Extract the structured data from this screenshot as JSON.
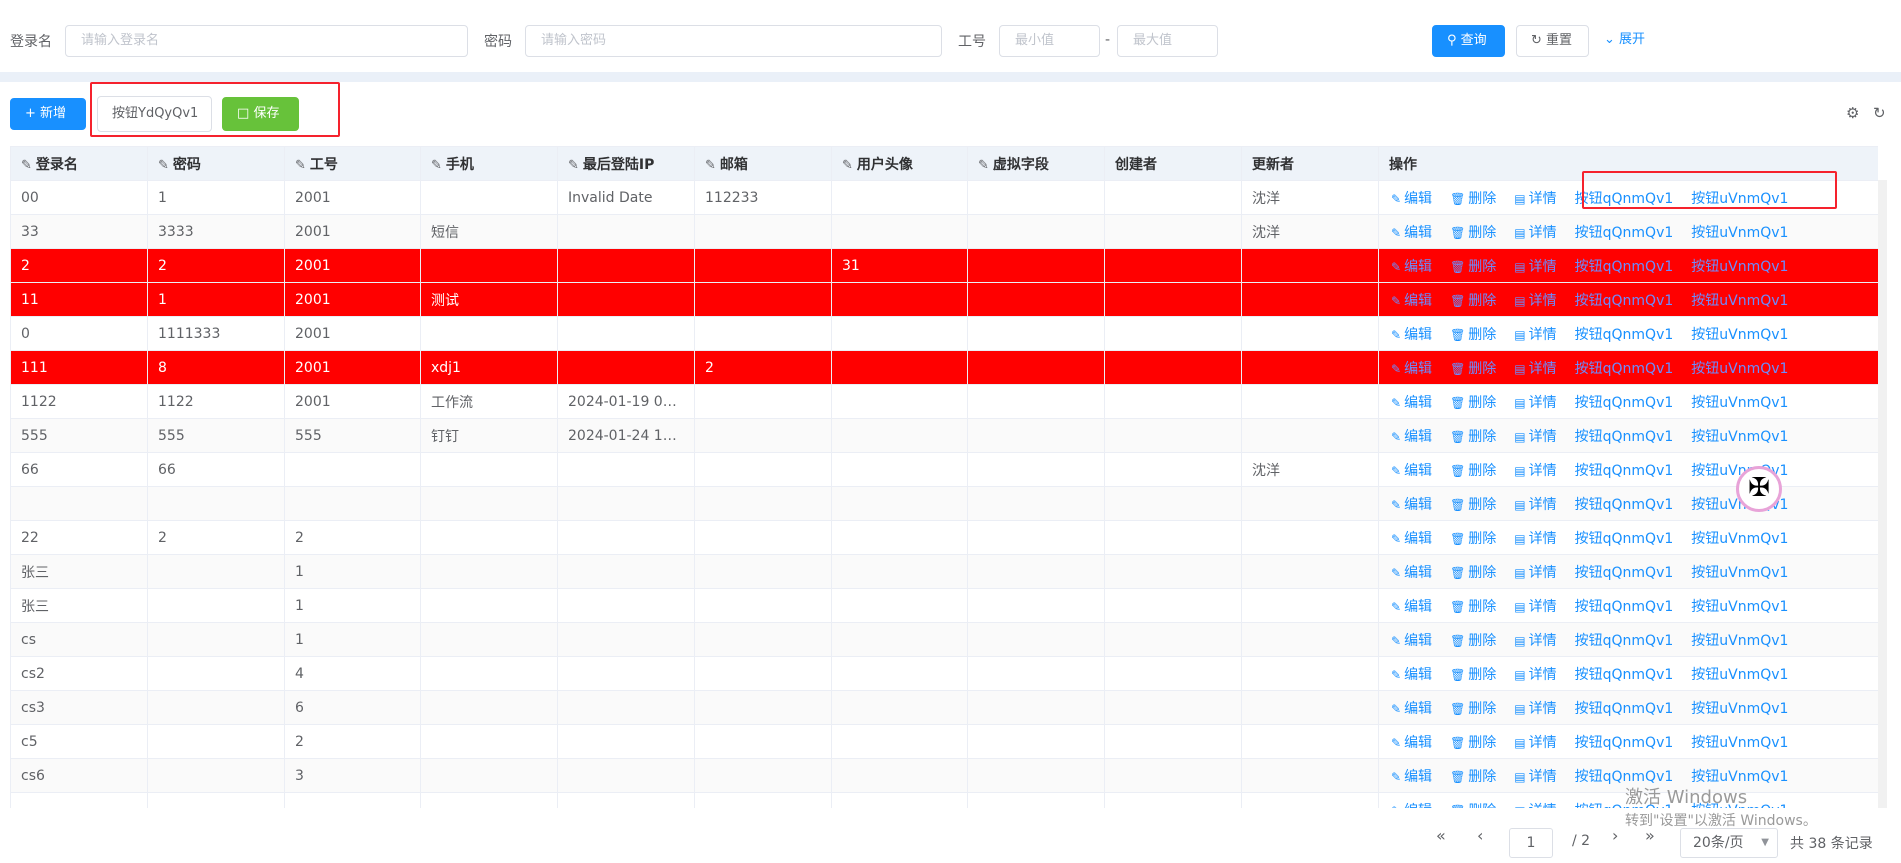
{
  "search": {
    "login_label": "登录名",
    "login_placeholder": "请输入登录名",
    "password_label": "密码",
    "password_placeholder": "请输入密码",
    "jobno_label": "工号",
    "jobno_min_placeholder": "最小值",
    "jobno_max_placeholder": "最大值",
    "range_sep": "-",
    "query_label": "查询",
    "reset_label": "重置",
    "expand_label": "展开"
  },
  "toolbar": {
    "add_label": "新增",
    "custom_button_label": "按钮YdQyQv1",
    "save_label": "保存"
  },
  "table": {
    "columns": [
      "登录名",
      "密码",
      "工号",
      "手机",
      "最后登陆IP",
      "邮箱",
      "用户头像",
      "虚拟字段",
      "创建者",
      "更新者",
      "操作"
    ],
    "actions": [
      "编辑",
      "删除",
      "详情",
      "按钮qQnmQv1",
      "按钮uVnmQv1"
    ],
    "rows": [
      {
        "c": [
          "00",
          "1",
          "2001",
          "",
          "Invalid Date",
          "112233",
          "",
          "",
          "",
          "沈洋"
        ],
        "hl": false
      },
      {
        "c": [
          "33",
          "3333",
          "2001",
          "短信",
          "",
          "",
          "",
          "",
          "",
          "沈洋"
        ],
        "hl": false
      },
      {
        "c": [
          "2",
          "2",
          "2001",
          "",
          "",
          "",
          "31",
          "",
          "",
          ""
        ],
        "hl": true
      },
      {
        "c": [
          "11",
          "1",
          "2001",
          "测试",
          "",
          "",
          "",
          "",
          "",
          ""
        ],
        "hl": true
      },
      {
        "c": [
          "0",
          "1111333",
          "2001",
          "",
          "",
          "",
          "",
          "",
          "",
          ""
        ],
        "hl": false
      },
      {
        "c": [
          "111",
          "8",
          "2001",
          "xdj1",
          "",
          "2",
          "",
          "",
          "",
          ""
        ],
        "hl": true
      },
      {
        "c": [
          "1122",
          "1122",
          "2001",
          "工作流",
          "2024-01-19 00:0...",
          "",
          "",
          "",
          "",
          ""
        ],
        "hl": false
      },
      {
        "c": [
          "555",
          "555",
          "555",
          "钉钉",
          "2024-01-24 17:0...",
          "",
          "",
          "",
          "",
          ""
        ],
        "hl": false
      },
      {
        "c": [
          "66",
          "66",
          "",
          "",
          "",
          "",
          "",
          "",
          "",
          "沈洋"
        ],
        "hl": false
      },
      {
        "c": [
          "",
          "",
          "",
          "",
          "",
          "",
          "",
          "",
          "",
          ""
        ],
        "hl": false
      },
      {
        "c": [
          "22",
          "2",
          "2",
          "",
          "",
          "",
          "",
          "",
          "",
          ""
        ],
        "hl": false
      },
      {
        "c": [
          "张三",
          "",
          "1",
          "",
          "",
          "",
          "",
          "",
          "",
          ""
        ],
        "hl": false
      },
      {
        "c": [
          "张三",
          "",
          "1",
          "",
          "",
          "",
          "",
          "",
          "",
          ""
        ],
        "hl": false
      },
      {
        "c": [
          "cs",
          "",
          "1",
          "",
          "",
          "",
          "",
          "",
          "",
          ""
        ],
        "hl": false
      },
      {
        "c": [
          "cs2",
          "",
          "4",
          "",
          "",
          "",
          "",
          "",
          "",
          ""
        ],
        "hl": false
      },
      {
        "c": [
          "cs3",
          "",
          "6",
          "",
          "",
          "",
          "",
          "",
          "",
          ""
        ],
        "hl": false
      },
      {
        "c": [
          "c5",
          "",
          "2",
          "",
          "",
          "",
          "",
          "",
          "",
          ""
        ],
        "hl": false
      },
      {
        "c": [
          "cs6",
          "",
          "3",
          "",
          "",
          "",
          "",
          "",
          "",
          ""
        ],
        "hl": false
      },
      {
        "c": [
          "",
          "",
          "",
          "",
          "",
          "",
          "",
          "",
          "",
          ""
        ],
        "hl": false
      }
    ]
  },
  "pagination": {
    "current_page": "1",
    "total_pages": "/ 2",
    "page_size": "20条/页",
    "total": "共 38 条记录"
  },
  "watermark": {
    "line1": "激活 Windows",
    "line2": "转到\"设置\"以激活 Windows。"
  },
  "colors": {
    "primary": "#1890ff",
    "success": "#67c23a",
    "row_highlight": "#ff0000",
    "annotation_box": "#f5222d"
  },
  "icons": {
    "query": "search-icon",
    "reset": "refresh-icon",
    "expand": "chevron-down-icon",
    "add": "plus-icon",
    "save": "save-icon",
    "settings": "gear-icon",
    "refresh": "refresh-icon",
    "edit": "edit-icon",
    "delete": "trash-icon",
    "detail": "document-icon"
  }
}
